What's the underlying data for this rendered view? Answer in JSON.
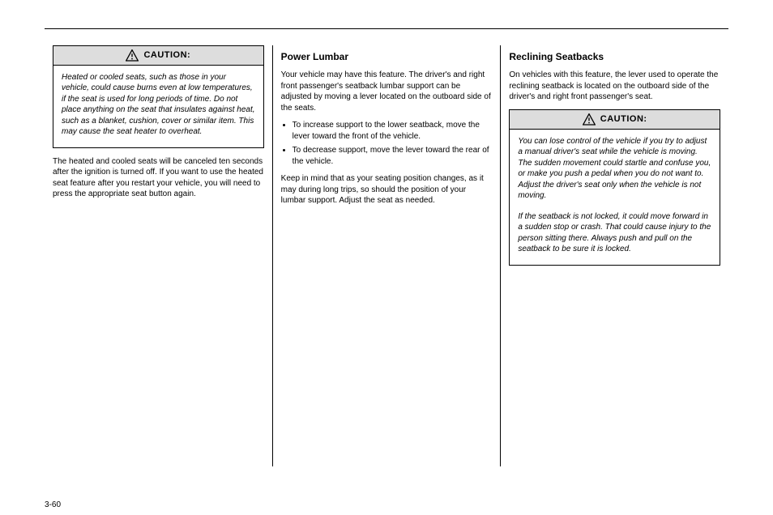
{
  "page_number": "3-60",
  "col1": {
    "caution_label": "CAUTION:",
    "caution_body_1": "Heated or cooled seats, such as those in your vehicle, could cause burns even at low temperatures, if the seat is used for long periods of time. Do not place anything on the seat that insulates against heat, such as a blanket, cushion, cover or similar item. This may cause the seat heater to overheat.",
    "p1": "The heated and cooled seats will be canceled ten seconds after the ignition is turned off. If you want to use the heated seat feature after you restart your vehicle, you will need to press the appropriate seat button again."
  },
  "col2": {
    "title": "Power Lumbar",
    "p1": "Your vehicle may have this feature. The driver's and right front passenger's seatback lumbar support can be adjusted by moving a lever located on the outboard side of the seats.",
    "bullets": [
      "To increase support to the lower seatback, move the lever toward the front of the vehicle.",
      "To decrease support, move the lever toward the rear of the vehicle."
    ],
    "p2": "Keep in mind that as your seating position changes, as it may during long trips, so should the position of your lumbar support. Adjust the seat as needed."
  },
  "col3": {
    "title": "Reclining Seatbacks",
    "p1": "On vehicles with this feature, the lever used to operate the reclining seatback is located on the outboard side of the driver's and right front passenger's seat.",
    "caution_label": "CAUTION:",
    "caution_body_1": "You can lose control of the vehicle if you try to adjust a manual driver's seat while the vehicle is moving. The sudden movement could startle and confuse you, or make you push a pedal when you do not want to. Adjust the driver's seat only when the vehicle is not moving.",
    "caution_body_2": "If the seatback is not locked, it could move forward in a sudden stop or crash. That could cause injury to the person sitting there. Always push and pull on the seatback to be sure it is locked."
  }
}
